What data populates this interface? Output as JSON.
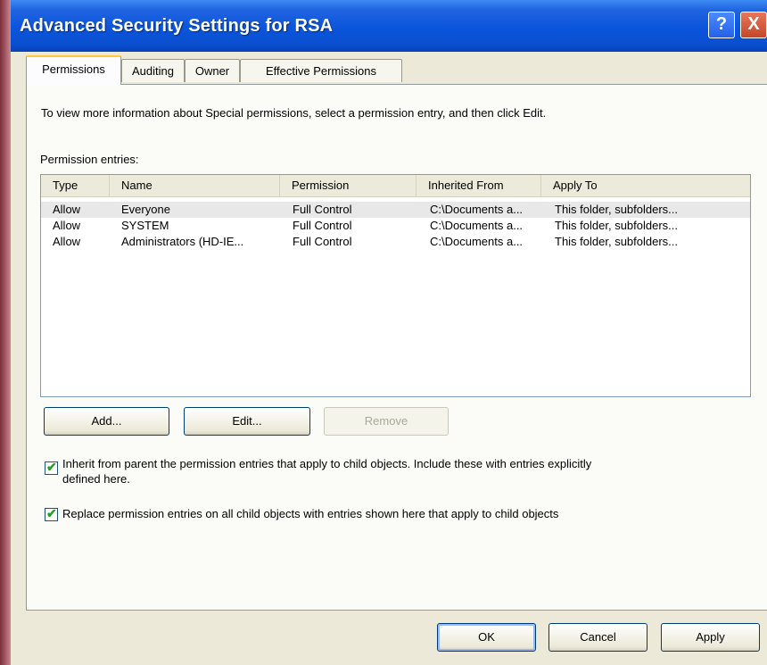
{
  "window": {
    "title": "Advanced Security Settings for RSA",
    "help_label": "?",
    "close_label": "X"
  },
  "tabs": [
    {
      "label": "Permissions",
      "active": true
    },
    {
      "label": "Auditing",
      "active": false
    },
    {
      "label": "Owner",
      "active": false
    },
    {
      "label": "Effective Permissions",
      "active": false
    }
  ],
  "permissions": {
    "info_text": "To view more information about Special permissions, select a permission entry, and then click Edit.",
    "entries_label": "Permission entries:",
    "columns": [
      "Type",
      "Name",
      "Permission",
      "Inherited From",
      "Apply To"
    ],
    "rows": [
      {
        "type": "Allow",
        "name": "Everyone",
        "permission": "Full Control",
        "inherited_from": "C:\\Documents a...",
        "apply_to": "This folder, subfolders..."
      },
      {
        "type": "Allow",
        "name": "SYSTEM",
        "permission": "Full Control",
        "inherited_from": "C:\\Documents a...",
        "apply_to": "This folder, subfolders..."
      },
      {
        "type": "Allow",
        "name": "Administrators (HD-IE...",
        "permission": "Full Control",
        "inherited_from": "C:\\Documents a...",
        "apply_to": "This folder, subfolders..."
      }
    ],
    "buttons": {
      "add": "Add...",
      "edit": "Edit...",
      "remove": "Remove"
    },
    "inherit_checkbox": {
      "checked": true,
      "line1": "Inherit from parent the permission entries that apply to child objects. Include these with entries explicitly",
      "line2": "defined here."
    },
    "replace_checkbox": {
      "checked": true,
      "label": "Replace permission entries on all child objects with entries shown here that apply to child objects"
    }
  },
  "footer": {
    "ok": "OK",
    "cancel": "Cancel",
    "apply": "Apply"
  },
  "colors": {
    "titlebar": "#0a55dc",
    "dialog_bg": "#ece9d8",
    "panel_bg": "#fbfbf8",
    "check": "#21a121"
  }
}
